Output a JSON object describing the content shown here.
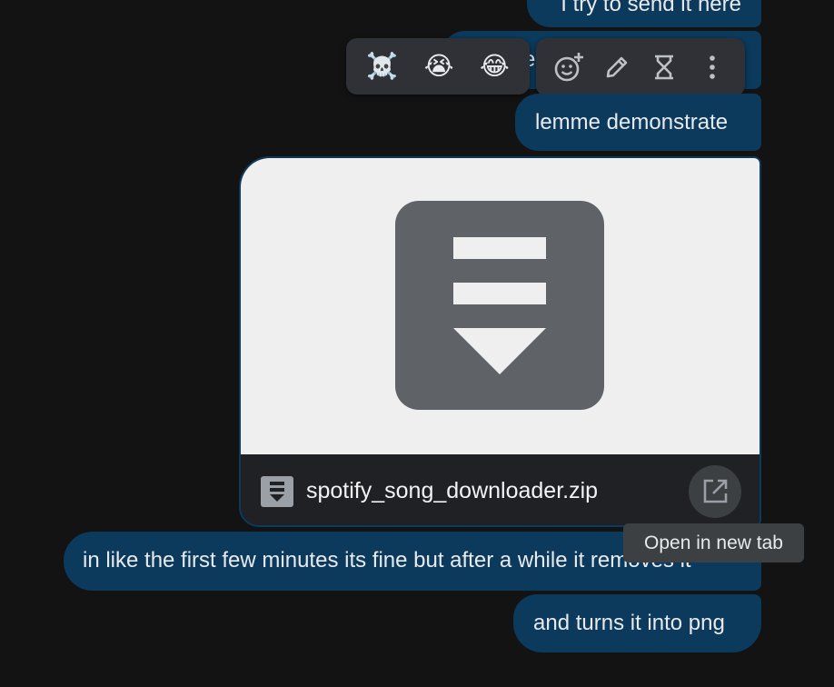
{
  "messages": {
    "top_partial": "I try to send it here",
    "demo": "lemme demonstrate",
    "long": "in like the first few minutes its fine but after a while it removes it",
    "png": "and turns it into png",
    "hidden_fragment": "e"
  },
  "reaction_bar": {
    "emojis": [
      "☠️",
      "😭",
      "😂"
    ]
  },
  "action_bar": {
    "icons": [
      "add-reaction-icon",
      "edit-icon",
      "hourglass-icon",
      "more-vert-icon"
    ]
  },
  "attachment": {
    "file_name": "spotify_song_downloader.zip",
    "icon": "file-download-icon"
  },
  "tooltip": {
    "text": "Open in new tab"
  },
  "colors": {
    "background": "#131313",
    "bubble": "#0b3a5c",
    "toolbar": "#2f3136",
    "thumb": "#5f6368"
  }
}
